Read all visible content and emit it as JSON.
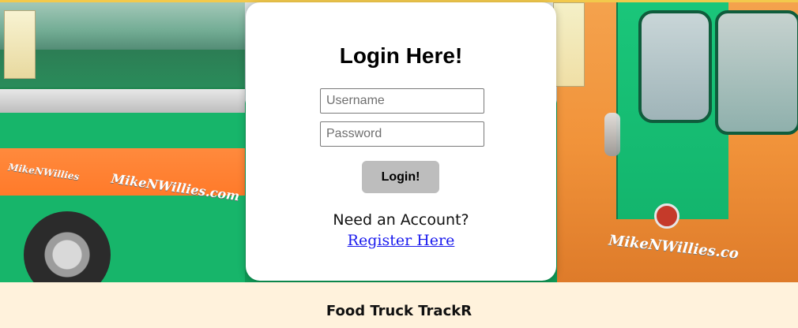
{
  "hero": {
    "alt_text": "",
    "brand_text_left": "MikeNWillies.com",
    "brand_text_left_small": "MikeNWillies",
    "brand_text_right": "MikeNWillies.co"
  },
  "login": {
    "title": "Login Here!",
    "username_placeholder": "Username",
    "password_placeholder": "Password",
    "submit_label": "Login!",
    "need_account_text": "Need an Account?",
    "register_link_text": "Register Here"
  },
  "footer": {
    "brand": "Food Truck TrackR"
  },
  "colors": {
    "footer_bg": "#fff2dc",
    "top_border": "#f2c94c",
    "button_bg": "#bdbdbd",
    "link": "#1a1aee"
  }
}
